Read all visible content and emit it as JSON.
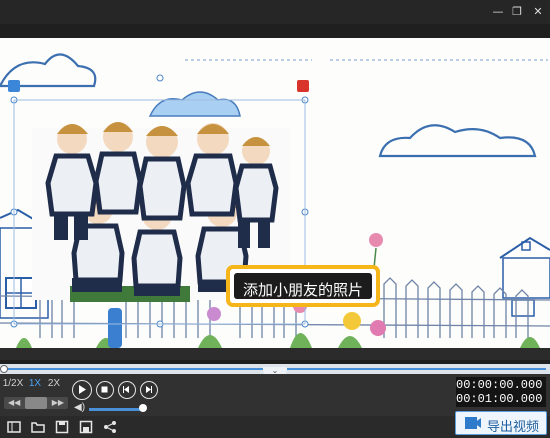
{
  "window": {
    "minimize_glyph": "—",
    "restore_glyph": "❐",
    "close_glyph": "✕"
  },
  "stage": {
    "caption": "添加小朋友的照片",
    "background_color": "#fdfdfb",
    "callout_border_color": "#f6b519"
  },
  "playback": {
    "speeds": [
      "1/2X",
      "1X",
      "2X"
    ],
    "active_speed": "1X",
    "current_time": "00:00:00.000",
    "total_time": "00:01:00.000",
    "volume_level": 0.9,
    "accent_color": "#4a90d9"
  },
  "bottom": {
    "export_label": "导出视频",
    "icons": [
      "timeline-icon",
      "open-folder-icon",
      "save-icon",
      "save-as-icon",
      "share-icon"
    ]
  }
}
